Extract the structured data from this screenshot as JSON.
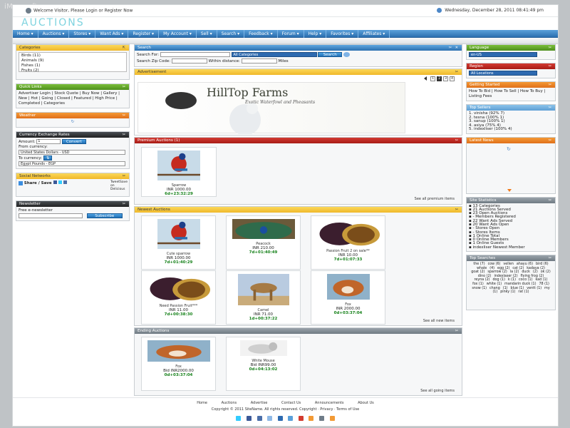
{
  "watermark": "iMewsoft",
  "topbar": {
    "welcome": "Welcome Visitor, Please Login or Register Now",
    "datetime": "Wednesday, December 28, 2011 08:41:49 pm"
  },
  "logo": "AUCTIONS",
  "nav": [
    "Home ▾",
    "Auctions ▾",
    "Stores ▾",
    "Want Ads ▾",
    "Register ▾",
    "My Account ▾",
    "Sell ▾",
    "Search ▾",
    "Feedback ▾",
    "Forum ▾",
    "Help ▾",
    "Favorites ▾",
    "Affiliates ▾"
  ],
  "left": {
    "categories": {
      "title": "Categories",
      "items": [
        "Birds (11)",
        "Animals (9)",
        "Fishes (1)",
        "Fruits (2)"
      ]
    },
    "quicklinks": {
      "title": "Quick Links",
      "text": "Advertiser Login | Stock Quote | Buy Now | Gallery | New | Hot | Going | Closed | Featured | High Price | Completed | Categories"
    },
    "weather": {
      "title": "Weather"
    },
    "currency": {
      "title": "Currency Exchange Rates",
      "amount_label": "Amount:",
      "amount_value": "1",
      "convert": "Convert",
      "from_label": "From currency:",
      "from_value": "United States Dollars - USD",
      "to_label": "To currency:",
      "swap": "⇅",
      "to_value": "Egypt Pounds - EGP"
    },
    "social": {
      "title": "Social Networks",
      "share": "Share / Save",
      "tweet": "TweetSave on Delicious"
    },
    "newsletter": {
      "title": "Newsletter",
      "label": "Free e-newsletter",
      "subscribe": "Subscribe"
    }
  },
  "mid": {
    "search": {
      "title": "Search",
      "search_for": "Search For:",
      "category": "All Categories",
      "button": "Search",
      "zip_label": "Search Zip Code:",
      "within": "Within distance:",
      "miles": "Miles"
    },
    "advert": {
      "title": "Advertisement",
      "pages": [
        "1",
        "2",
        "3",
        "4"
      ],
      "brand": "HillTop Farms",
      "tagline": "Exotic Waterfowl and Pheasants"
    },
    "premium": {
      "title": "Premium Auctions (1)",
      "items": [
        {
          "name": "Sparrow",
          "price": "INR 1000.00",
          "time": "6d+23:32:29",
          "art": "bird"
        }
      ],
      "see_all": "See all premium items"
    },
    "newest": {
      "title": "Newest Auctions",
      "items": [
        {
          "name": "Cute sparrow",
          "price": "INR 1000.00",
          "time": "7d+01:40:29",
          "art": "bird"
        },
        {
          "name": "Peacock",
          "price": "INR 210.00",
          "time": "7d+01:40:49",
          "art": "peacock"
        },
        {
          "name": "Passion Fruit 2 on sale**",
          "price": "INR 10.00",
          "time": "7d+01:07:33",
          "art": "fruit"
        },
        {
          "name": "Need Passion Fruit***",
          "price": "INR 11.00",
          "time": "7d+00:38:30",
          "art": "fruit"
        },
        {
          "name": "Camel",
          "price": "INR 71.00",
          "time": "1d+00:37:22",
          "art": "camel"
        },
        {
          "name": "Fox",
          "price": "INR 2000.00",
          "time": "0d+03:37:04",
          "art": "fox"
        }
      ],
      "see_all": "See all new items"
    },
    "ending": {
      "title": "Ending Auctions",
      "items": [
        {
          "name": "Fox",
          "price": "Bid INR2000.00",
          "time": "0d+03:37:04",
          "art": "fox"
        },
        {
          "name": "White Mouse",
          "price": "Bid INR99.00",
          "time": "0d+04:13:02",
          "art": "mouse"
        }
      ],
      "see_all": "See all going items"
    }
  },
  "right": {
    "language": {
      "title": "Language",
      "value": "en-US"
    },
    "region": {
      "title": "Region",
      "value": "All Locations"
    },
    "getting_started": {
      "title": "Getting Started",
      "text": "How To Bid | How To Sell | How To Buy | Listing Fees"
    },
    "top_sellers": {
      "title": "Top Sellers",
      "items": [
        "1. vinisha (92% 7)",
        "2. tesna (100% 1)",
        "3. sanup (100% 1)",
        "4. asiya (75% 4)",
        "5. indexliser (100% 4)"
      ]
    },
    "latest_news": {
      "title": "Latest News"
    },
    "site_statistics": {
      "title": "Site Statistics",
      "items": [
        "13 Categories",
        "21 Auctions Served",
        "23 Open Auctions",
        "- Members Registered",
        "22 Want Ads Served",
        "20 Want Ads Open",
        "- Stores Open",
        "- Stores Items",
        "1 Online Total",
        "0 Online Members",
        "1 Online Guests",
        "indexliser Newest Member"
      ]
    },
    "top_searches": {
      "title": "Top Searches",
      "tags": [
        "the (7)",
        "cow (6)",
        "vellen",
        "ahayu (6)",
        "bird (6)",
        "whale",
        "(4)",
        "egg (2)",
        "cat (2)",
        "kadaya (2)",
        "goat (2)",
        "sparrow (2)",
        "la (2)",
        "duck",
        "(2)",
        "ok (2)",
        "dino (2)",
        "indexlaser (2)",
        "flying frog (2)",
        "reyna (2)",
        "dog (1)",
        "k (1)",
        "coco (1)",
        "kad (1)",
        "fox (1)",
        "white (1)",
        "mandarin duck (1)",
        "78 (1)",
        "snow (1)",
        "chang",
        "(1)",
        "blue (1)",
        "ventt (1)",
        "my",
        "(1)",
        "pinky (1)",
        "rat (1)"
      ]
    }
  },
  "footer": {
    "links": [
      "Home",
      "Auctions",
      "Advertise",
      "Contact Us",
      "Announcements",
      "About Us"
    ],
    "copyright": "Copyright © 2011 SiteName. All rights reserved. Copyright · Privacy · Terms of Use"
  },
  "colors": {
    "nav": "#2b6fb0",
    "price_time": "#17821b",
    "logo": "#7ed3df"
  }
}
